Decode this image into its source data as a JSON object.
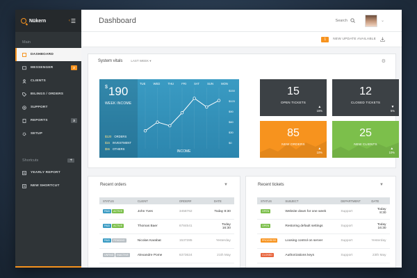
{
  "app": {
    "name": "Nükern"
  },
  "header": {
    "title": "Dashboard",
    "search_label": "Search"
  },
  "update": {
    "count": "1",
    "text": "NEW UPDATE AVAILABLE"
  },
  "sidebar": {
    "main_label": "Main",
    "items": [
      {
        "label": "DASHBOARD",
        "icon": "dashboard-icon"
      },
      {
        "label": "MESSENGER",
        "icon": "messenger-icon",
        "badge": "2"
      },
      {
        "label": "CLIENTS",
        "icon": "clients-icon"
      },
      {
        "label": "BILINGS / ORDERS",
        "icon": "tag-icon"
      },
      {
        "label": "SUPPORT",
        "icon": "support-icon"
      },
      {
        "label": "REPORTS",
        "icon": "reports-icon",
        "badge": "3"
      },
      {
        "label": "SETUP",
        "icon": "gear-icon"
      }
    ],
    "shortcuts_label": "Shortcuts",
    "shortcuts": [
      {
        "label": "YEARLY REPORT"
      },
      {
        "label": "NEW SHORTCUT"
      }
    ]
  },
  "vitals": {
    "title": "System vitals",
    "period": "LAST WEEK",
    "currency": "$",
    "week_income": "190",
    "week_label": "WEEK INCOME",
    "legend": [
      {
        "value": "$120",
        "label": "ORDERS"
      },
      {
        "value": "$15",
        "label": "INVESTMENT"
      },
      {
        "value": "$55",
        "label": "OTHERS"
      }
    ],
    "days": [
      "TUE",
      "WED",
      "THU",
      "FRI",
      "SAT",
      "SUN",
      "MON"
    ],
    "y_ticks": [
      "$150",
      "$120",
      "$90",
      "$60",
      "$30",
      "$0"
    ],
    "chart_label": "INCOME"
  },
  "chart_data": {
    "type": "line",
    "categories": [
      "TUE",
      "WED",
      "THU",
      "FRI",
      "SAT",
      "SUN",
      "MON"
    ],
    "values": [
      38,
      62,
      52,
      88,
      128,
      104,
      122
    ],
    "ylim": [
      0,
      150
    ],
    "xlabel": "INCOME"
  },
  "tiles": {
    "open": {
      "value": "15",
      "label": "OPEN TICKETS",
      "pct": "15%"
    },
    "closed": {
      "value": "12",
      "label": "CLOSED TICKETS",
      "pct": "5%"
    },
    "orders": {
      "value": "85",
      "label": "NEW ORDERS",
      "pct": "10%"
    },
    "clients": {
      "value": "25",
      "label": "NEW CLIENTS",
      "pct": "10%"
    }
  },
  "orders": {
    "title": "Recent orders",
    "columns": [
      "STATUS",
      "CLIENT",
      "ORDER#",
      "DATE"
    ],
    "rows": [
      {
        "tags": [
          "PAID",
          "ACTIVE"
        ],
        "client": "John Yves",
        "order": "3458762",
        "date": "Today 8:30"
      },
      {
        "tags": [
          "PAID",
          "ACTIVE"
        ],
        "client": "Thomas Baer",
        "order": "6784541",
        "date": "Today 16:30"
      },
      {
        "tags": [
          "PAID",
          "PENDING"
        ],
        "client": "Nicolas Karabat",
        "order": "1537285",
        "date": "Yesterday"
      },
      {
        "tags": [
          "UNPAID",
          "INACTIVE"
        ],
        "client": "Alexandre Pome",
        "order": "6373624",
        "date": "21th May"
      }
    ]
  },
  "tickets": {
    "title": "Recent tickets",
    "columns": [
      "STATUS",
      "SUBJECT",
      "DEPARTMENT",
      "DATE"
    ],
    "rows": [
      {
        "status": "OPEN",
        "subject": "Website down for one week",
        "department": "Support",
        "date": "Today 8:30"
      },
      {
        "status": "OPEN",
        "subject": "Restoring default settings",
        "department": "Support",
        "date": "Today 16:30"
      },
      {
        "status": "PROGRESS",
        "subject": "Loosing control on server",
        "department": "Support",
        "date": "Yesterday"
      },
      {
        "status": "CLOSED",
        "subject": "Authorizations keys",
        "department": "Support",
        "date": "23th May"
      }
    ]
  },
  "colors": {
    "accent": "#f7931e",
    "green": "#7cbf4b",
    "blue": "#3a9bc3",
    "dark": "#3c4145"
  }
}
